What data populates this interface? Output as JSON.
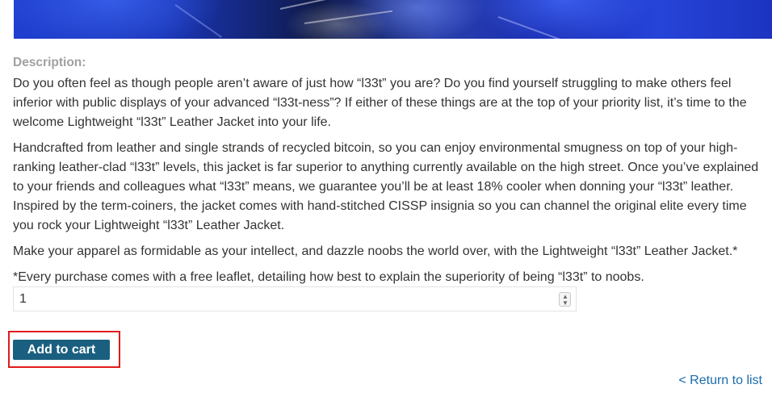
{
  "product": {
    "description_label": "Description:",
    "paragraphs": [
      "Do you often feel as though people aren’t aware of just how “l33t” you are? Do you find yourself struggling to make others feel inferior with public displays of your advanced “l33t-ness”? If either of these things are at the top of your priority list, it’s time to the welcome Lightweight “l33t” Leather Jacket into your life.",
      "Handcrafted from leather and single strands of recycled bitcoin, so you can enjoy environmental smugness on top of your high-ranking leather-clad “l33t” levels, this jacket is far superior to anything currently available on the high street. Once you’ve explained to your friends and colleagues what “l33t” means, we guarantee you’ll be at least 18% cooler when donning your “l33t” leather. Inspired by the term-coiners, the jacket comes with hand-stitched CISSP insignia so you can channel the original elite every time you rock your Lightweight “l33t” Leather Jacket.",
      "Make your apparel as formidable as your intellect, and dazzle noobs the world over, with the Lightweight “l33t” Leather Jacket.*",
      "*Every purchase comes with a free leaflet, detailing how best to explain the superiority of being “l33t” to noobs."
    ]
  },
  "cart": {
    "quantity_value": "1",
    "add_button_label": "Add to cart"
  },
  "navigation": {
    "return_link_label": "< Return to list"
  },
  "icons": {
    "stepper": "up-down-chevrons-icon"
  },
  "colors": {
    "button_bg": "#1a5f7f",
    "link": "#1a6cab",
    "highlight_border": "#e01b1b",
    "label_gray": "#a0a0a0"
  }
}
